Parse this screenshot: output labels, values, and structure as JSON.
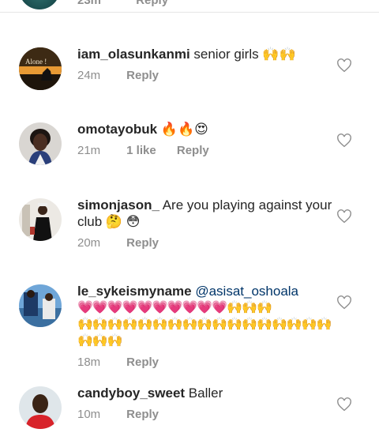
{
  "top_partial": {
    "time": "23m",
    "reply": "Reply"
  },
  "comments": [
    {
      "username": "iam_olasunkanmi",
      "text": " senior girls",
      "emoji": "🙌🙌",
      "time": "24m",
      "likes": "",
      "reply": "Reply",
      "avatar_caption": "Alone !"
    },
    {
      "username": "omotayobuk",
      "text": " ",
      "emoji": "🔥🔥😍",
      "time": "21m",
      "likes": "1 like",
      "reply": "Reply"
    },
    {
      "username": "simonjason_",
      "text": " Are you playing against your club",
      "emoji": "🤔 😳",
      "time": "20m",
      "likes": "",
      "reply": "Reply"
    },
    {
      "username": "le_sykeismyname",
      "mention": " @asisat_oshoala",
      "hearts": "💗💗💗💗💗💗💗💗💗💗",
      "hands_inline": "🙌🙌🙌",
      "hands_line": "🙌🙌🙌🙌🙌🙌🙌🙌🙌🙌🙌🙌🙌🙌🙌🙌🙌🙌🙌🙌",
      "time": "18m",
      "likes": "",
      "reply": "Reply"
    },
    {
      "username": "candyboy_sweet",
      "text": " Baller",
      "time": "10m",
      "likes": "",
      "reply": "Reply"
    }
  ],
  "colors": {
    "text": "#262626",
    "muted": "#8e8e8e",
    "mention": "#003569"
  }
}
